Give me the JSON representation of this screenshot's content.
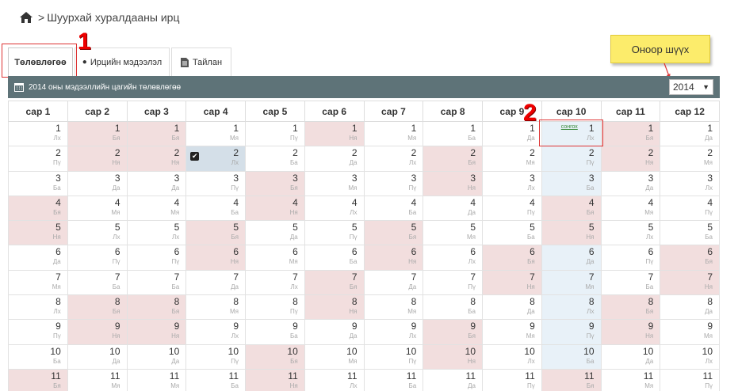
{
  "breadcrumb": {
    "sep": ">",
    "text": "Шуурхай хуралдааны ирц"
  },
  "tabs": [
    {
      "label": "Төлөвлөгөө",
      "active": true
    },
    {
      "label": "Ирцийн мэдээлэл",
      "active": false
    },
    {
      "label": "Тайлан",
      "active": false
    }
  ],
  "annotations": {
    "one": "1",
    "two": "2",
    "callout": "Оноор шүүх"
  },
  "plan_bar": {
    "title": "2014 оны мэдээллийн цагийн төлөвлөгөө"
  },
  "year_select": {
    "value": "2014",
    "caret": "▼"
  },
  "colors": {
    "header_bar": "#5e7378",
    "weekend": "#f2dede",
    "selected_column": "#e8f1f8",
    "callout": "#fcec6b",
    "annotation": "#dd2222"
  },
  "months": [
    "сар 1",
    "сар 2",
    "сар 3",
    "сар 4",
    "сар 5",
    "сар 6",
    "сар 7",
    "сар 8",
    "сар 9",
    "сар 10",
    "сар 11",
    "сар 12"
  ],
  "first_weekday": [
    2,
    5,
    5,
    1,
    3,
    6,
    1,
    4,
    0,
    2,
    5,
    0
  ],
  "weekday_abbr": [
    "Да",
    "Мя",
    "Лх",
    "Пү",
    "Ба",
    "Бя",
    "Ня"
  ],
  "visible_days": 11,
  "selected_month_index": 9,
  "checked_cell": {
    "month_index": 3,
    "day": 2
  },
  "selected_cell": {
    "month_index": 9,
    "day": 1,
    "tag": "сонгох"
  }
}
